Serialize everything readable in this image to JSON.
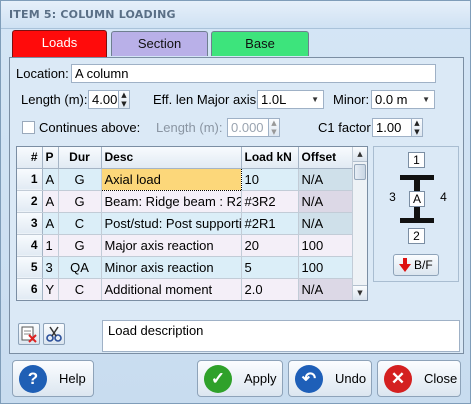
{
  "window": {
    "title": "ITEM 5: COLUMN LOADING"
  },
  "tabs": [
    {
      "label": "Loads",
      "color": "#ff0b0b",
      "active": true
    },
    {
      "label": "Section",
      "color": "#b9b0e8",
      "active": false
    },
    {
      "label": "Base",
      "color": "#3de47c",
      "active": false
    }
  ],
  "form": {
    "location_label": "Location:",
    "location_value": "A column",
    "length_label": "Length (m):",
    "length_value": "4.00",
    "eff_label": "Eff. len Major axis:",
    "eff_value": "1.0L",
    "minor_label": "Minor:",
    "minor_value": "0.0 m",
    "continues_label": "Continues above:",
    "continues_checked": false,
    "length2_label": "Length (m):",
    "length2_value": "0.000",
    "c1_label": "C1 factor",
    "c1_value": "1.00"
  },
  "table": {
    "headers": [
      "#",
      "P",
      "Dur",
      "Desc",
      "Load kN",
      "Offset"
    ],
    "rows": [
      {
        "n": "1",
        "p": "A",
        "dur": "G",
        "desc": "Axial load",
        "load": "10",
        "offset": "N/A"
      },
      {
        "n": "2",
        "p": "A",
        "dur": "G",
        "desc": "Beam: Ridge beam : R2",
        "load": "#3R2",
        "offset": "N/A"
      },
      {
        "n": "3",
        "p": "A",
        "dur": "C",
        "desc": "Post/stud: Post supporti",
        "load": "#2R1",
        "offset": "N/A"
      },
      {
        "n": "4",
        "p": "1",
        "dur": "G",
        "desc": "Major axis reaction",
        "load": "20",
        "offset": "100"
      },
      {
        "n": "5",
        "p": "3",
        "dur": "QA",
        "desc": "Minor axis reaction",
        "load": "5",
        "offset": "100"
      },
      {
        "n": "6",
        "p": "Y",
        "dur": "C",
        "desc": "Additional moment",
        "load": "2.0",
        "offset": "N/A"
      }
    ]
  },
  "axis": {
    "top": "1",
    "left": "3",
    "center": "A",
    "right": "4",
    "bottom": "2",
    "bf_label": "B/F"
  },
  "description": {
    "placeholder": "Load description"
  },
  "buttons": {
    "help": "Help",
    "apply": "Apply",
    "undo": "Undo",
    "close": "Close"
  },
  "colors": {
    "help_icon": "#1f5fb5",
    "apply_icon": "#2fa12a",
    "undo_icon": "#1e5fb8",
    "close_icon": "#d42020",
    "selected_cell": "#fcd77a"
  }
}
